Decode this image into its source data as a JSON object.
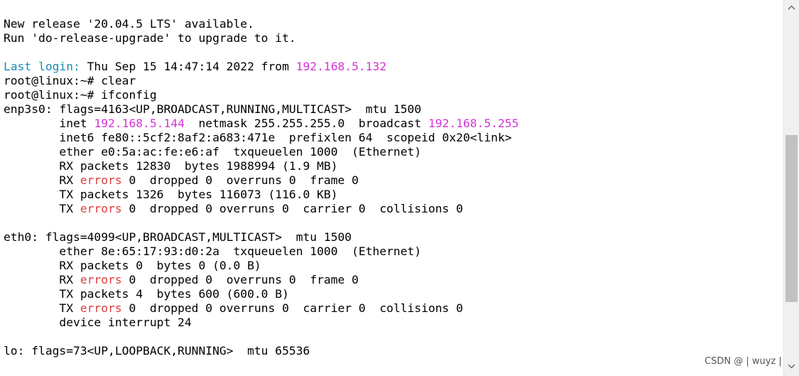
{
  "colors": {
    "default": "#000000",
    "cyan": "#1a8ab5",
    "magenta": "#d633d6",
    "red": "#e03c3c"
  },
  "terminal": {
    "lines": [
      [
        {
          "t": "New release '20.04.5 LTS' available.",
          "c": "default"
        }
      ],
      [
        {
          "t": "Run 'do-release-upgrade' to upgrade to it.",
          "c": "default"
        }
      ],
      [],
      [
        {
          "t": "Last login:",
          "c": "cyan"
        },
        {
          "t": " Thu Sep 15 14:47:14 2022 from ",
          "c": "default"
        },
        {
          "t": "192.168.5.132",
          "c": "magenta"
        }
      ],
      [
        {
          "t": "root@linux:~# clear",
          "c": "default"
        }
      ],
      [
        {
          "t": "root@linux:~# ifconfig",
          "c": "default"
        }
      ],
      [
        {
          "t": "enp3s0: flags=4163<UP,BROADCAST,RUNNING,MULTICAST>  mtu 1500",
          "c": "default"
        }
      ],
      [
        {
          "t": "        inet ",
          "c": "default"
        },
        {
          "t": "192.168.5.144",
          "c": "magenta"
        },
        {
          "t": "  netmask 255.255.255.0  broadcast ",
          "c": "default"
        },
        {
          "t": "192.168.5.255",
          "c": "magenta"
        }
      ],
      [
        {
          "t": "        inet6 fe80::5cf2:8af2:a683:471e  prefixlen 64  scopeid 0x20<link>",
          "c": "default"
        }
      ],
      [
        {
          "t": "        ether e0:5a:ac:fe:e6:af  txqueuelen 1000  (Ethernet)",
          "c": "default"
        }
      ],
      [
        {
          "t": "        RX packets 12830  bytes 1988994 (1.9 MB)",
          "c": "default"
        }
      ],
      [
        {
          "t": "        RX ",
          "c": "default"
        },
        {
          "t": "errors",
          "c": "red"
        },
        {
          "t": " 0  dropped 0  overruns 0  frame 0",
          "c": "default"
        }
      ],
      [
        {
          "t": "        TX packets 1326  bytes 116073 (116.0 KB)",
          "c": "default"
        }
      ],
      [
        {
          "t": "        TX ",
          "c": "default"
        },
        {
          "t": "errors",
          "c": "red"
        },
        {
          "t": " 0  dropped 0 overruns 0  carrier 0  collisions 0",
          "c": "default"
        }
      ],
      [],
      [
        {
          "t": "eth0: flags=4099<UP,BROADCAST,MULTICAST>  mtu 1500",
          "c": "default"
        }
      ],
      [
        {
          "t": "        ether 8e:65:17:93:d0:2a  txqueuelen 1000  (Ethernet)",
          "c": "default"
        }
      ],
      [
        {
          "t": "        RX packets 0  bytes 0 (0.0 B)",
          "c": "default"
        }
      ],
      [
        {
          "t": "        RX ",
          "c": "default"
        },
        {
          "t": "errors",
          "c": "red"
        },
        {
          "t": " 0  dropped 0  overruns 0  frame 0",
          "c": "default"
        }
      ],
      [
        {
          "t": "        TX packets 4  bytes 600 (600.0 B)",
          "c": "default"
        }
      ],
      [
        {
          "t": "        TX ",
          "c": "default"
        },
        {
          "t": "errors",
          "c": "red"
        },
        {
          "t": " 0  dropped 0 overruns 0  carrier 0  collisions 0",
          "c": "default"
        }
      ],
      [
        {
          "t": "        device interrupt 24",
          "c": "default"
        }
      ],
      [],
      [
        {
          "t": "lo: flags=73<UP,LOOPBACK,RUNNING>  mtu 65536",
          "c": "default"
        }
      ]
    ]
  },
  "scrollbar": {
    "up_icon": "chevron-up-icon",
    "down_icon": "chevron-down-icon"
  },
  "watermark": {
    "text": "CSDN @ | wuyz |"
  }
}
